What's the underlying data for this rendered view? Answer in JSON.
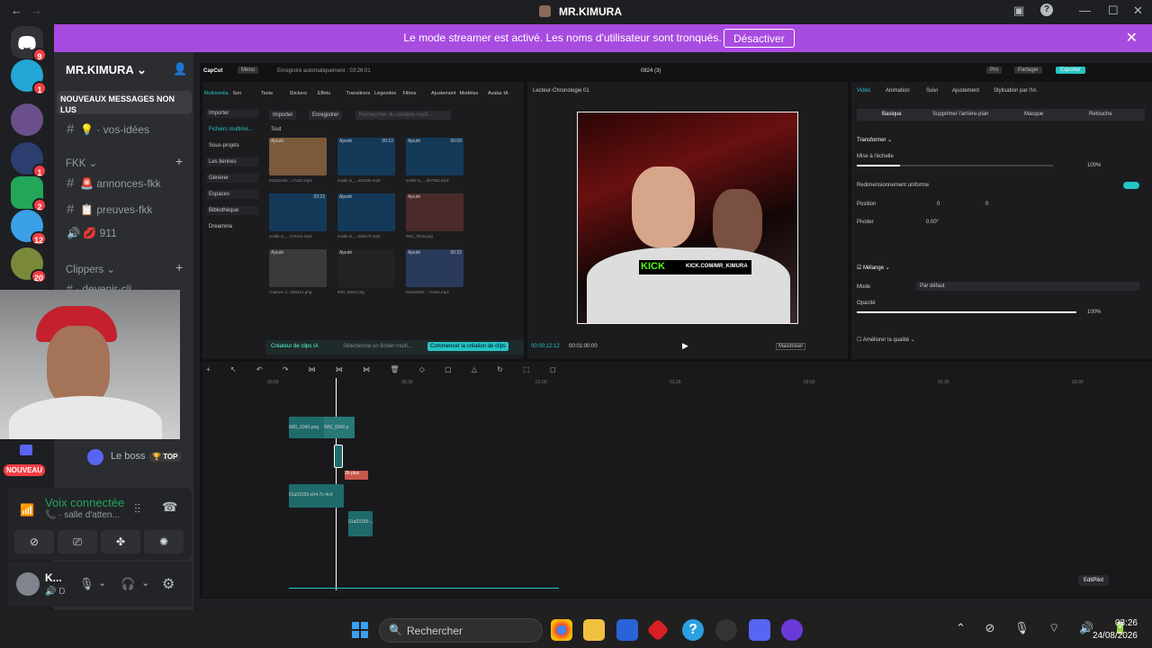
{
  "window": {
    "title": "MR.KIMURA"
  },
  "banner": {
    "text": "Le mode streamer est activé. Les noms d'utilisateur sont tronqués.",
    "button": "Désactiver"
  },
  "guild_badges": [
    "9",
    "1",
    "1",
    "2",
    "12",
    "20"
  ],
  "server": {
    "name": "MR.KIMURA",
    "unread_label": "NOUVEAUX MESSAGES NON LUS",
    "channels": [
      {
        "icon": "#",
        "label": "vos-idées",
        "emoji": "💡"
      },
      {
        "icon": "#",
        "label": "annonces-fkk",
        "emoji": "🚨"
      },
      {
        "icon": "#",
        "label": "preuves-fkk",
        "emoji": "📋"
      },
      {
        "icon": "🔊",
        "label": "911",
        "emoji": "💋"
      }
    ],
    "categories": [
      "FKK",
      "Clippers"
    ],
    "partial_channel": "devenir-cli",
    "voice_user": "Le boss",
    "voice_user_badge": "TOP",
    "new_label": "NOUVEAU"
  },
  "voice": {
    "status": "Voix connectée",
    "channel": "salle d'atten..."
  },
  "user": {
    "name": "K...",
    "status": "D"
  },
  "capcut": {
    "app": "CapCut",
    "menu": "Menu",
    "autosave": "Enregistré automatiquement : 03:26:01",
    "project": "0824 (3)",
    "top_buttons": [
      "Pro",
      "Partager",
      "Exporter"
    ],
    "tools": [
      "Multimédia",
      "Son",
      "Texte",
      "Stickers",
      "Effets",
      "Transitions",
      "Légendes",
      "Filtres",
      "Ajustement",
      "Modèles",
      "Avatar IA"
    ],
    "side_menu": [
      "Importer",
      "Fichiers multimé...",
      "Sous-projets",
      "Les tiennes",
      "Générer",
      "Espaces",
      "Bibliothèque",
      "Dreamina"
    ],
    "media_buttons": [
      "Importer",
      "Enregistrer"
    ],
    "media_search": "Rechercher du contenu multi...",
    "tout": "Tout",
    "media": [
      {
        "name": "01a03155-...17a02.mp4",
        "tag": "Ajouté",
        "dur": ""
      },
      {
        "name": "sostik.io_...416180.mp3",
        "tag": "Ajouté",
        "dur": "00:12"
      },
      {
        "name": "sostik.io_...367983.mp3",
        "tag": "Ajouté",
        "dur": "00:09"
      },
      {
        "name": "sostik.io_...273101.mp3",
        "tag": "",
        "dur": "03:23"
      },
      {
        "name": "sostik.io_...535475.mp3",
        "tag": "Ajouté",
        "dur": ""
      },
      {
        "name": "IMG_7519.png",
        "tag": "Ajouté",
        "dur": ""
      },
      {
        "name": "Capture d...530441.png",
        "tag": "Ajouté",
        "dur": ""
      },
      {
        "name": "IMG_6940.png",
        "tag": "Ajouté",
        "dur": ""
      },
      {
        "name": "01a03155-...7e4ee.mp4",
        "tag": "Ajouté",
        "dur": "00:32"
      }
    ],
    "clip_creator": "Créateur de clips IA",
    "clip_hint": "Sélectionne un fichier multi...",
    "clip_button": "Commencer la création de clips",
    "player_title": "Lecteur-Chronologie 01",
    "overlay_text": "KICK.COM/MR_KIMURA",
    "kick": "KICK",
    "time_current": "00:00:12:12",
    "time_total": "00:01:00:00",
    "player_ratio": "Maximiser",
    "props_tabs": [
      "Vidéo",
      "Animation",
      "Suivi",
      "Ajustement",
      "Stylisation par l'IA"
    ],
    "sub_tabs": [
      "Basique",
      "Supprimer l'arrière-plan",
      "Masque",
      "Retouche"
    ],
    "transform": "Transformer",
    "scale_label": "Mise à l'échelle",
    "scale_value": "100%",
    "uniform": "Redimensionnement uniforme",
    "position": "Position",
    "pos_x": "0",
    "pos_y": "0",
    "rotate": "Pivoter",
    "rotate_value": "0.00°",
    "blend": "Mélange",
    "mode": "Mode",
    "mode_value": "Par défaut",
    "opacity": "Opacité",
    "opacity_value": "100%",
    "quality": "Améliorer la qualité",
    "ruler": [
      "00:00",
      "00:30",
      "01:00",
      "01:30",
      "02:00",
      "02:30",
      "03:00"
    ],
    "clip_labels": [
      "IMG_6940.png",
      "IMG_6940.p",
      "2h plus",
      "01a03155-ch4-7c-4c4",
      "01a03155-..."
    ],
    "editpilot": "EditPilot"
  },
  "taskbar": {
    "search": "Rechercher",
    "time": "03:26",
    "date": "24/08/2026"
  },
  "colors": {
    "banner": "#a84be0",
    "discord_bg": "#1e1f22",
    "channels_bg": "#2b2d31",
    "capcut_accent": "#26c4c4",
    "kick_green": "#53fc18"
  }
}
